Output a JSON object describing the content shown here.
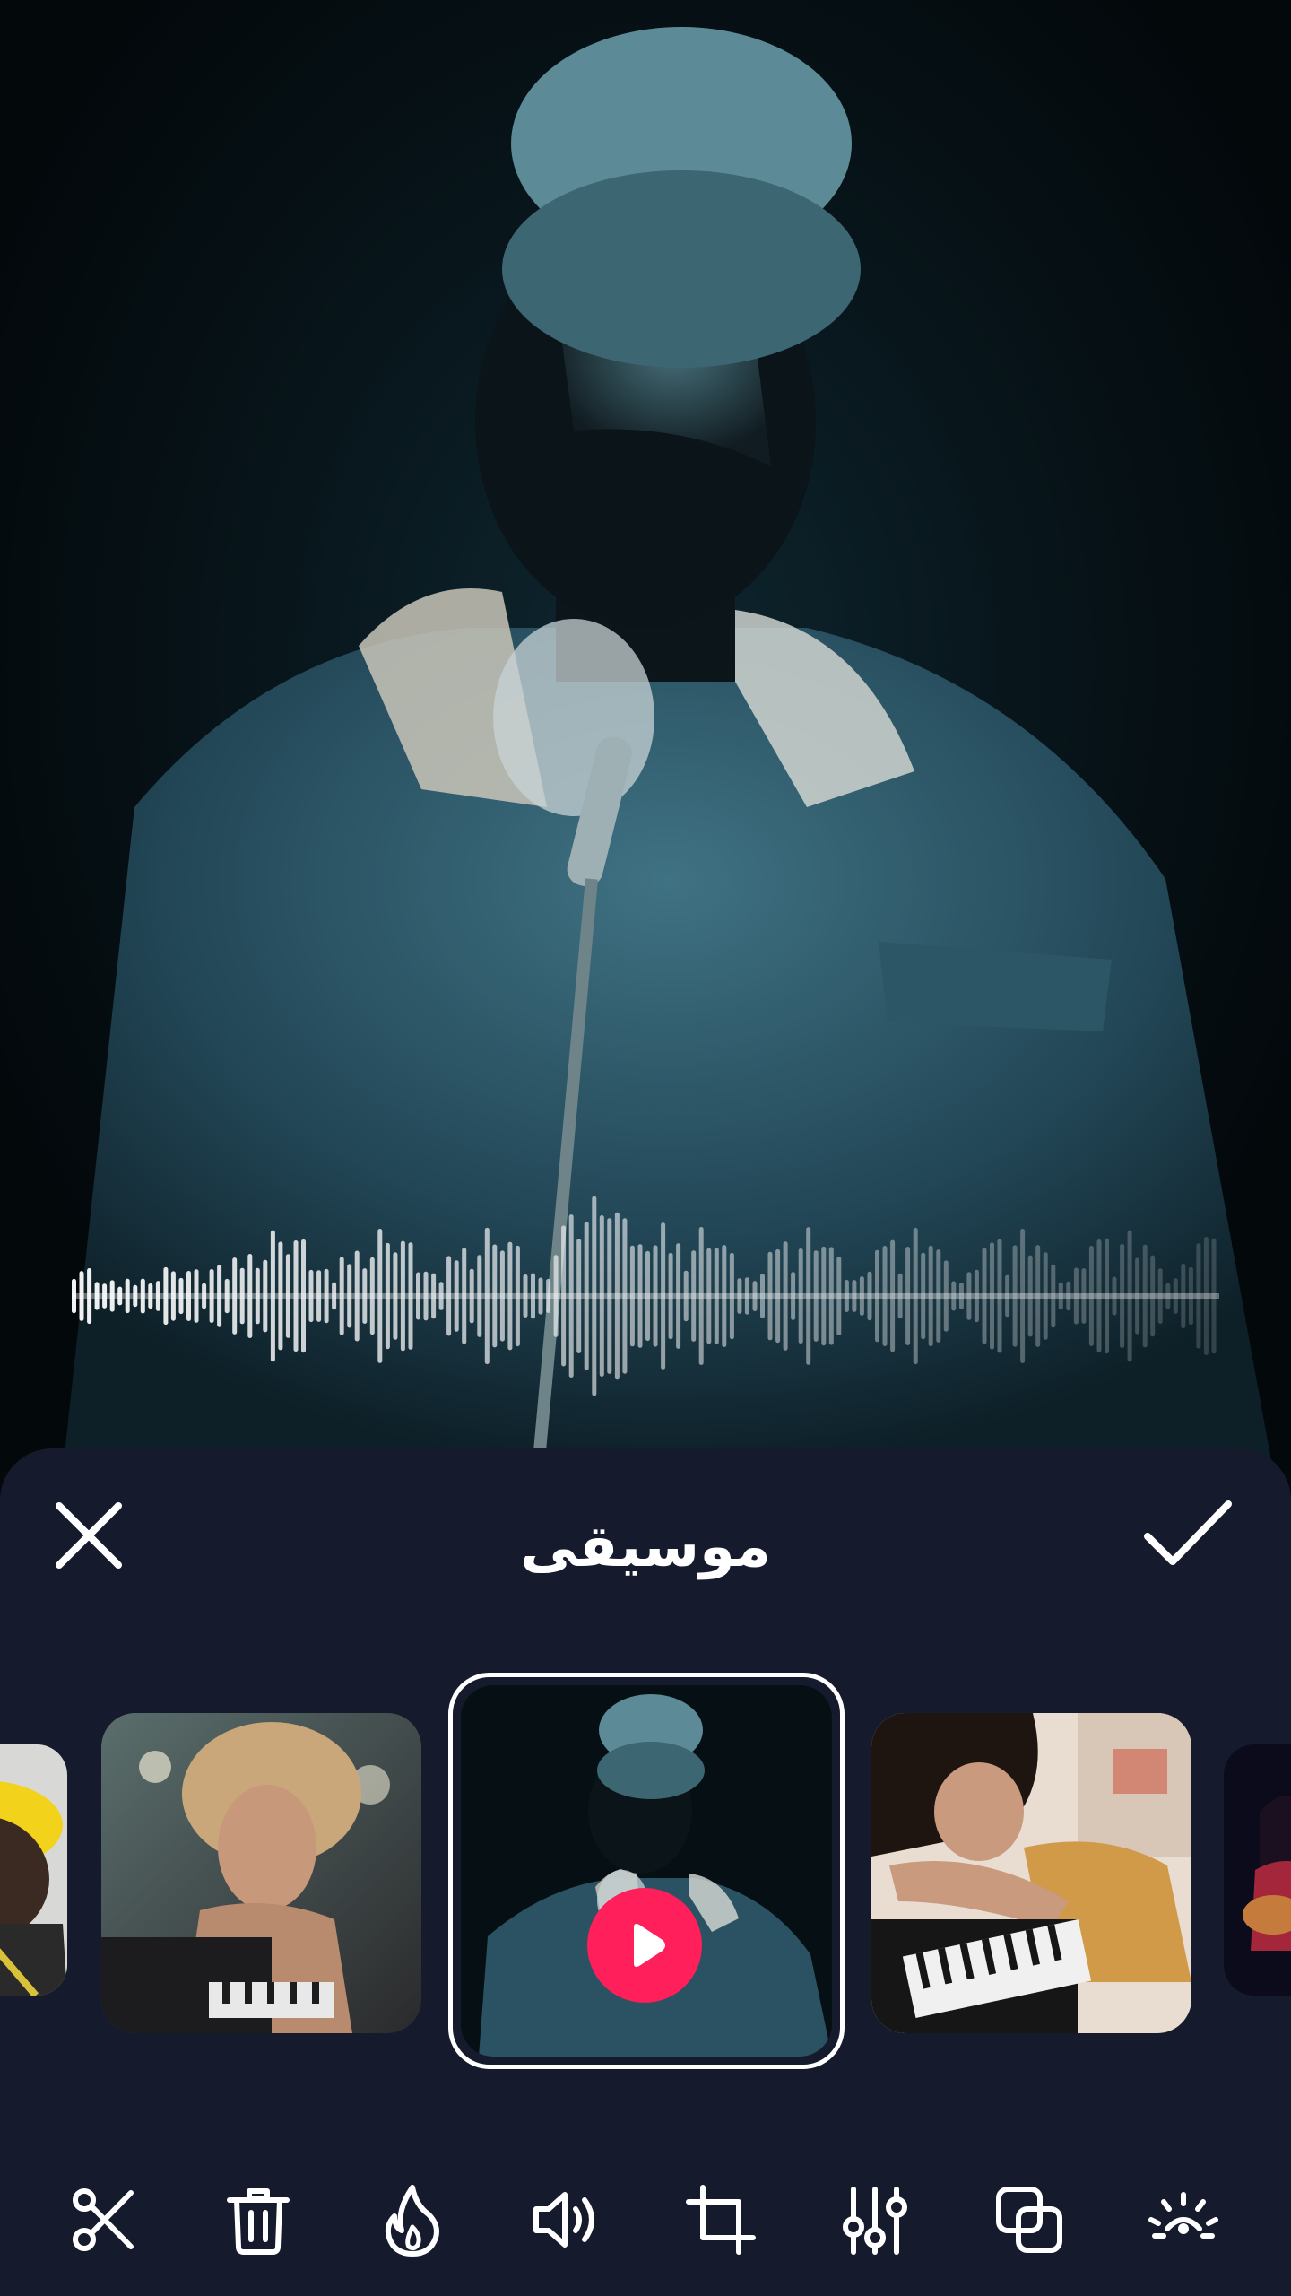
{
  "screen": {
    "background_photo": "singer-with-microphone",
    "waveform": "audio-waveform"
  },
  "sheet": {
    "title": "موسيقى",
    "close_icon": "close-icon",
    "confirm_icon": "checkmark-icon"
  },
  "tracks": [
    {
      "name": "track-thumbnail-edge-left",
      "photo": "yellow-hair-performer"
    },
    {
      "name": "track-thumbnail-1",
      "photo": "curly-hair-woman-keyboard"
    },
    {
      "name": "track-thumbnail-selected",
      "photo": "singer-with-microphone",
      "selected": true
    },
    {
      "name": "track-thumbnail-3",
      "photo": "woman-leaning-on-piano"
    },
    {
      "name": "track-thumbnail-edge-right",
      "photo": "woman-with-guitar"
    }
  ],
  "toolbar": {
    "tools": [
      "scissors-icon",
      "trash-icon",
      "flame-icon",
      "volume-icon",
      "crop-icon",
      "sliders-icon",
      "overlay-icon",
      "brightness-icon"
    ]
  },
  "colors": {
    "sheet_bg": "#161a2d",
    "accent": "#ff1f5a",
    "icon": "#ffffff"
  }
}
